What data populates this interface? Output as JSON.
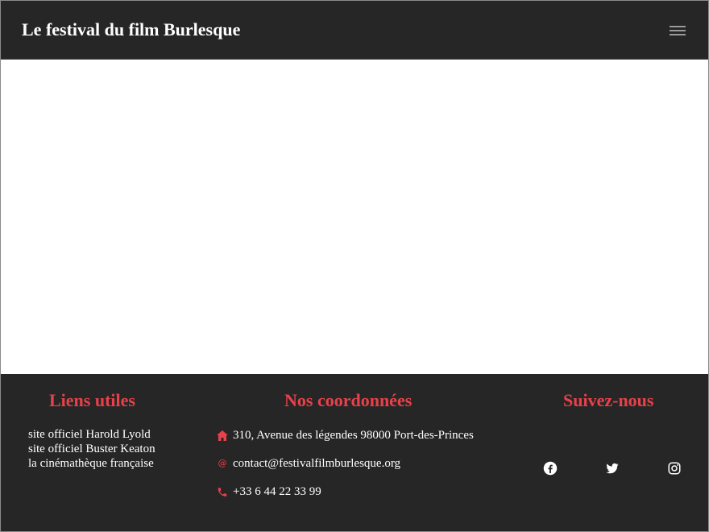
{
  "header": {
    "title": "Le festival du film Burlesque",
    "menu_icon": "hamburger-icon"
  },
  "footer": {
    "links_title": "Liens utiles",
    "links": [
      "site officiel Harold Lyold",
      "site officiel Buster Keaton",
      "la cinémathèque française"
    ],
    "contact_title": "Nos coordonnées",
    "contact": {
      "address": "310, Avenue des légendes 98000 Port-des-Princes",
      "email": "contact@festivalfilmburlesque.org",
      "phone": "+33 6 44 22 33 99"
    },
    "social_title": "Suivez-nous",
    "social_icons": [
      "facebook-icon",
      "twitter-icon",
      "instagram-icon"
    ]
  },
  "colors": {
    "header_bg": "#262626",
    "accent": "#e8414a",
    "text": "#ffffff"
  }
}
